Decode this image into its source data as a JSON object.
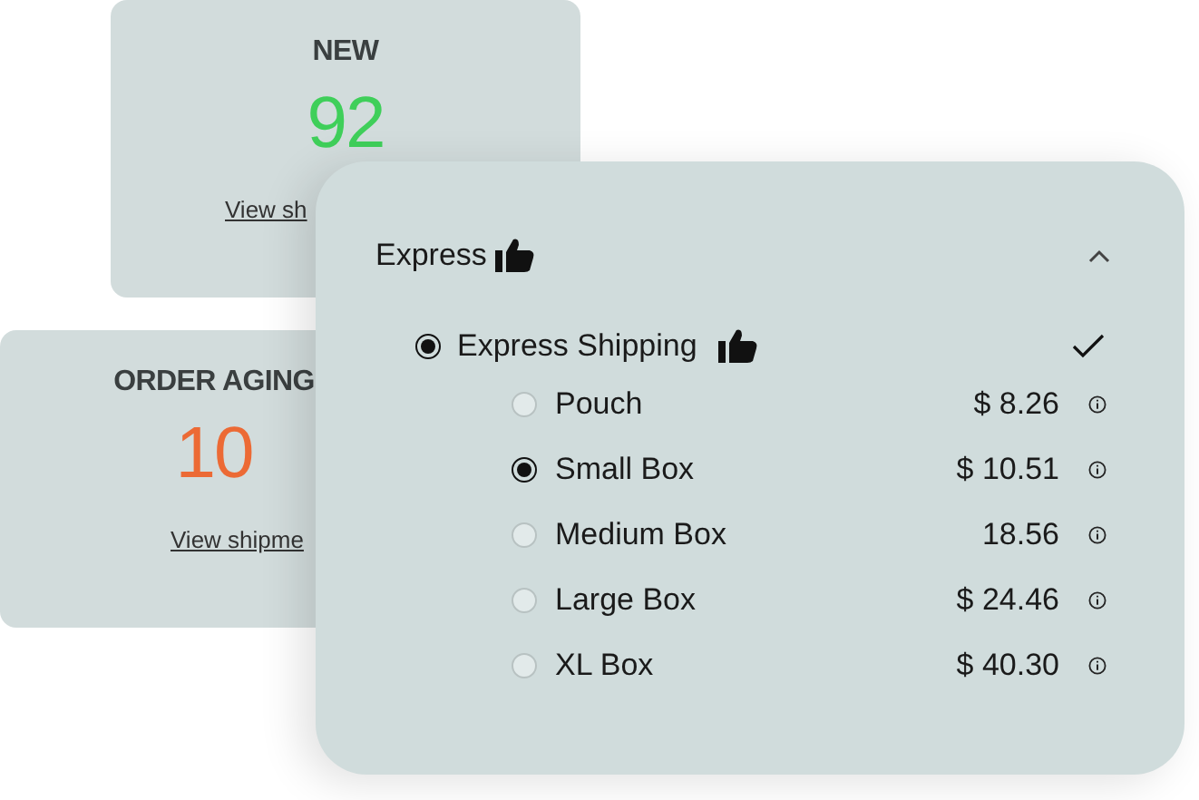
{
  "cards": [
    {
      "title": "NEW",
      "value": "92",
      "color": "#3fcf5a",
      "link": "View sh"
    },
    {
      "title": "ORDER AGING",
      "value": "10",
      "color": "#ec6a35",
      "link": "View shipme"
    }
  ],
  "panel": {
    "title": "Express",
    "expanded": true,
    "method": {
      "label": "Express Shipping",
      "selected": true,
      "confirmed": true
    },
    "options": [
      {
        "label": "Pouch",
        "price": "$ 8.26",
        "selected": false
      },
      {
        "label": "Small Box",
        "price": "$ 10.51",
        "selected": true
      },
      {
        "label": "Medium Box",
        "price": "18.56",
        "selected": false
      },
      {
        "label": "Large Box",
        "price": "$ 24.46",
        "selected": false
      },
      {
        "label": "XL Box",
        "price": "$ 40.30",
        "selected": false
      }
    ]
  }
}
